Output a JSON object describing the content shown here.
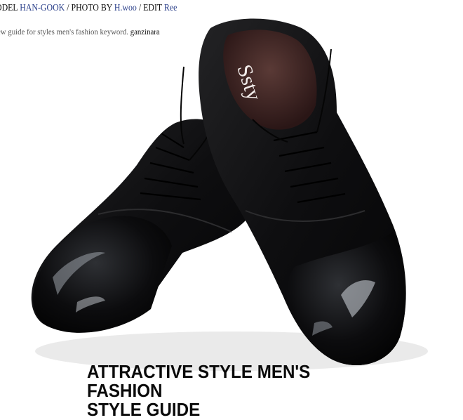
{
  "credits": {
    "model_prefix": "ODEL ",
    "model_name": "HAN-GOOK",
    "photo_prefix": " / PHOTO BY ",
    "photographer": "H.woo",
    "edit_prefix": " / EDIT ",
    "editor": "Ree"
  },
  "subline": {
    "text": "ew guide for styles men's fashion keyword. ",
    "brand": "ganzinara"
  },
  "insole_logo": "Ssty",
  "headline": {
    "line1": "ATTRACTIVE STYLE MEN'S",
    "line2": "FASHION",
    "line3": "STYLE GUIDE"
  },
  "colors": {
    "credit_highlight": "#2a3f8a",
    "background": "#ffffff",
    "shoe": "#0b0b0c",
    "insole": "#3a2222"
  }
}
